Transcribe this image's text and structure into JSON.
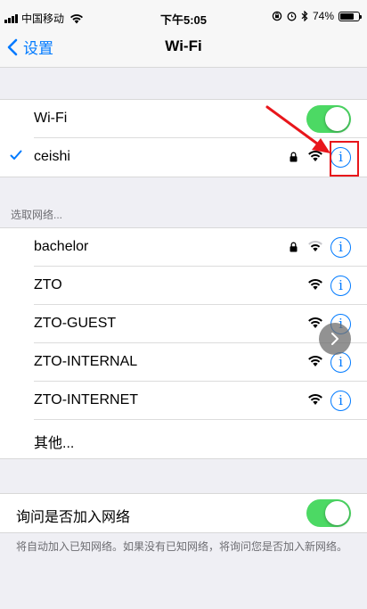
{
  "status_bar": {
    "carrier": "中国移动",
    "time": "下午5:05",
    "battery_percent": "74%",
    "battery_level": 0.74
  },
  "nav": {
    "back_label": "设置",
    "title": "Wi-Fi"
  },
  "wifi_toggle": {
    "label": "Wi-Fi",
    "on": true
  },
  "connected": {
    "name": "ceishi",
    "locked": true
  },
  "networks_header": "选取网络...",
  "networks": [
    {
      "name": "bachelor",
      "locked": true
    },
    {
      "name": "ZTO",
      "locked": false
    },
    {
      "name": "ZTO-GUEST",
      "locked": false
    },
    {
      "name": "ZTO-INTERNAL",
      "locked": false
    },
    {
      "name": "ZTO-INTERNET",
      "locked": false
    }
  ],
  "other_label": "其他...",
  "ask_join": {
    "label": "询问是否加入网络",
    "on": true
  },
  "ask_join_footer": "将自动加入已知网络。如果没有已知网络，将询问您是否加入新网络。",
  "colors": {
    "accent": "#007aff",
    "toggle_on": "#4cd964",
    "annotation": "#e8161b"
  }
}
